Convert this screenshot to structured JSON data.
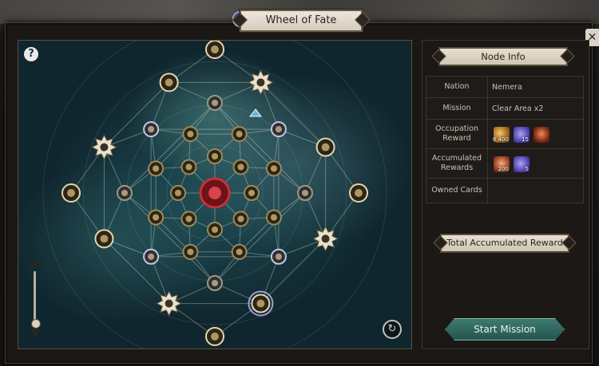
{
  "window": {
    "title": "Wheel of Fate",
    "info_icon": "i",
    "close_icon": "✕"
  },
  "map": {
    "help_icon": "?",
    "reset_icon": "↻"
  },
  "node_info": {
    "header": "Node Info",
    "rows": [
      {
        "label": "Nation",
        "value": "Nemera"
      },
      {
        "label": "Mission",
        "value": "Clear Area x2"
      },
      {
        "label": "Occupation Reward",
        "rewards": [
          {
            "icon": "gold-coin-icon",
            "qty": "6,400"
          },
          {
            "icon": "purple-token-icon",
            "qty": "15"
          },
          {
            "icon": "red-crystal-icon",
            "qty": ""
          }
        ]
      },
      {
        "label": "Accumulated Rewards",
        "rewards": [
          {
            "icon": "scroll-icon",
            "qty": "200"
          },
          {
            "icon": "purple-token-icon",
            "qty": "5"
          }
        ]
      },
      {
        "label": "Owned Cards",
        "value": ""
      }
    ]
  },
  "total_banner": "Total Accumulated Reward",
  "start_button": "Start Mission",
  "colors": {
    "accent": "#2f655e",
    "banner": "#e6dfd0",
    "core": "#8b1a22"
  }
}
